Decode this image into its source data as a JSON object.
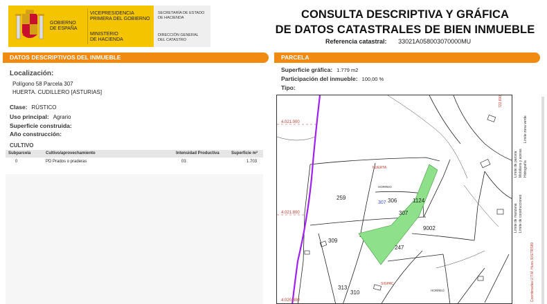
{
  "header": {
    "gov_name": "GOBIERNO\nDE ESPAÑA",
    "vicepresidencia": "VICEPRESIDENCIA\nPRIMERA DEL GOBIERNO",
    "ministerio": "MINISTERIO\nDE HACIENDA",
    "secretaria": "SECRETARÍA DE ESTADO\nDE HACIENDA",
    "direccion": "DIRECCIÓN GENERAL\nDEL CATASTRO",
    "title_line1": "CONSULTA DESCRIPTIVA Y GRÁFICA",
    "title_line2": "DE DATOS CATASTRALES DE BIEN INMUEBLE",
    "ref_label": "Referencia catastral:",
    "ref_value": "33021A058003070000MU"
  },
  "left": {
    "section_title": "DATOS DESCRIPTIVOS DEL INMUEBLE",
    "localizacion_label": "Localización:",
    "localizacion_line1": "Polígono 58 Parcela 307",
    "localizacion_line2": "HUERTA. CUDILLERO [ASTURIAS]",
    "clase_label": "Clase:",
    "clase_value": "RÚSTICO",
    "uso_label": "Uso principal:",
    "uso_value": "Agrario",
    "sup_construida_label": "Superficie construida:",
    "ano_label": "Año construcción:",
    "cultivo_title": "CULTIVO",
    "table": {
      "headers": [
        "Subparcela",
        "Cultivo/aprovechamiento",
        "Intensidad Productiva",
        "Superficie m²"
      ],
      "rows": [
        [
          "0",
          "PD Prados o praderas",
          "03",
          "1.703"
        ]
      ]
    }
  },
  "right": {
    "section_title": "PARCELA",
    "sup_grafica_label": "Superficie gráfica:",
    "sup_grafica_value": "1.779 m2",
    "participacion_label": "Participación del inmueble:",
    "participacion_value": "100,00 %",
    "tipo_label": "Tipo:",
    "map": {
      "coord_top": "4.021.000",
      "coord_mid": "4.021.800",
      "coord_bottom": "4.020.800",
      "coord_right": "722.600",
      "parcels": [
        "259",
        "306",
        "1124",
        "307",
        "9002",
        "309",
        "247",
        "313",
        "310"
      ],
      "red_label_a": "HUERTA",
      "red_label_b": "SIGPAC",
      "blue_label": "307",
      "small_label_a": "HORREO",
      "small_label_b": "HORREO",
      "legend": [
        "Límite de manzana",
        "Límite de parcela",
        "Límite de construcciones",
        "Mobiliario y aceras",
        "Límite zona verde",
        "Hidrografía"
      ],
      "legend_footer": "Coordenadas U.T.M. Huso 30 ETRS89"
    }
  },
  "colors": {
    "accent_orange": "#f08a10",
    "gov_yellow": "#f5c400",
    "parcel_green": "#8fe08a",
    "boundary_purple": "#a020f0"
  }
}
